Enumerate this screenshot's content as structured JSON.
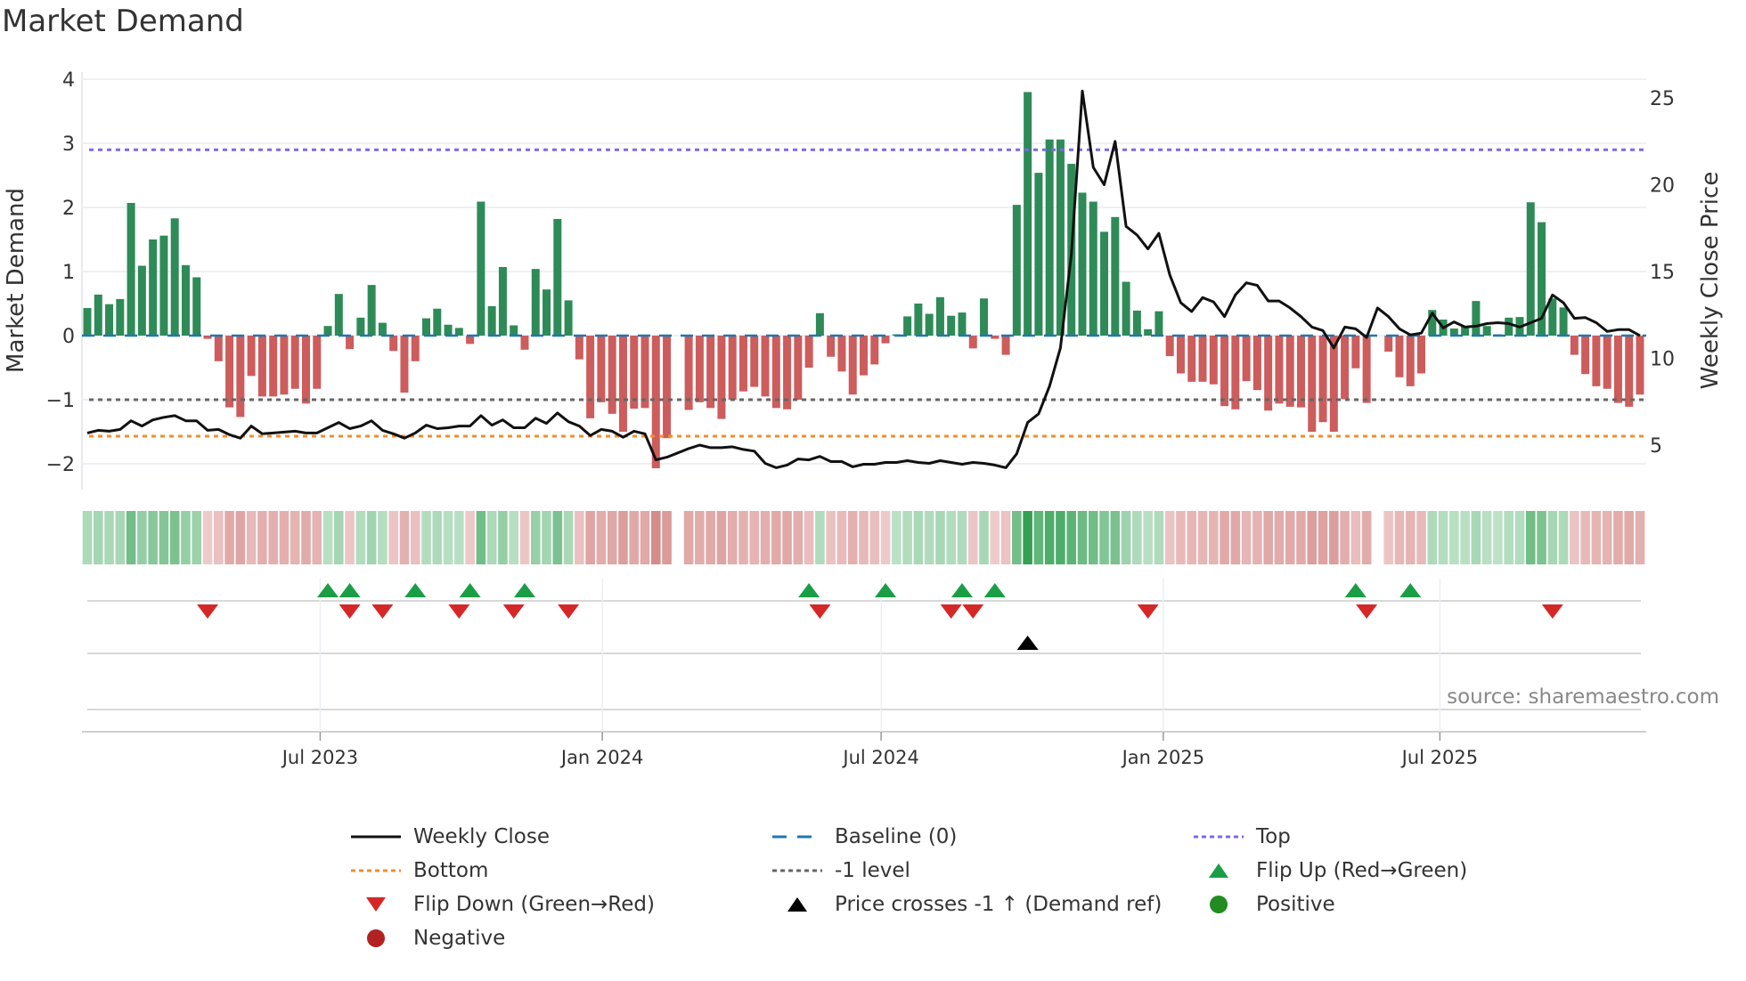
{
  "title": "Market Demand",
  "source": "source: sharemaestro.com",
  "colors": {
    "positive": "#2e8b57",
    "negative": "#cd5c5c",
    "price": "#111111",
    "baseline": "#1f77b4",
    "top": "#7b68ee",
    "bottom": "#f28e2b",
    "minus_one": "#666666",
    "flip_up": "#1a9e45",
    "flip_down": "#d62728",
    "cross": "#000000",
    "pos_dot": "#228b22",
    "neg_dot": "#b22222"
  },
  "legend": [
    {
      "label": "Weekly Close",
      "symbol": "solid-line",
      "color": "#111111"
    },
    {
      "label": "Baseline (0)",
      "symbol": "dashed-line",
      "color": "#1f77b4"
    },
    {
      "label": "Top",
      "symbol": "dotted-line",
      "color": "#7b68ee"
    },
    {
      "label": "Bottom",
      "symbol": "dotted-line",
      "color": "#f28e2b"
    },
    {
      "label": "-1 level",
      "symbol": "dotted-line",
      "color": "#666666"
    },
    {
      "label": "Flip Up (Red→Green)",
      "symbol": "triangle-up",
      "color": "#1a9e45"
    },
    {
      "label": "Flip Down (Green→Red)",
      "symbol": "triangle-down",
      "color": "#d62728"
    },
    {
      "label": "Price crosses -1 ↑ (Demand ref)",
      "symbol": "triangle-up",
      "color": "#000000"
    },
    {
      "label": "Positive",
      "symbol": "circle",
      "color": "#228b22"
    },
    {
      "label": "Negative",
      "symbol": "circle",
      "color": "#b22222"
    }
  ],
  "chart_data": {
    "type": "bar",
    "title": "Market Demand",
    "ylabel": "Market Demand",
    "y2label": "Weekly Close Price",
    "ylim": [
      -2.5,
      4.15
    ],
    "y2lim": [
      0.9,
      26.9
    ],
    "yticks": [
      -2,
      -1,
      0,
      1,
      2,
      3,
      4
    ],
    "ytick_labels": [
      "−2",
      "−1",
      "0",
      "1",
      "2",
      "3",
      "4"
    ],
    "y2ticks": [
      5,
      10,
      15,
      20,
      25
    ],
    "y2tick_labels": [
      "5",
      "10",
      "15",
      "20",
      "25"
    ],
    "xticks": [
      {
        "label": "Jul 2023",
        "week": 21.3
      },
      {
        "label": "Jan 2024",
        "week": 47.1
      },
      {
        "label": "Jul 2024",
        "week": 72.6
      },
      {
        "label": "Jan 2025",
        "week": 98.4
      },
      {
        "label": "Jul 2025",
        "week": 123.7
      }
    ],
    "levels": {
      "top": 2.9,
      "baseline": 0,
      "minus_one": -1,
      "bottom": -1.57
    },
    "demand": [
      0.43,
      0.64,
      0.49,
      0.57,
      2.07,
      1.09,
      1.5,
      1.56,
      1.83,
      1.1,
      0.91,
      -0.05,
      -0.4,
      -1.12,
      -1.27,
      -0.63,
      -0.95,
      -0.95,
      -0.92,
      -0.83,
      -1.06,
      -0.83,
      0.15,
      0.65,
      -0.21,
      0.28,
      0.79,
      0.2,
      -0.24,
      -0.89,
      -0.4,
      0.27,
      0.42,
      0.17,
      0.12,
      -0.13,
      2.09,
      0.46,
      1.07,
      0.16,
      -0.22,
      1.04,
      0.72,
      1.82,
      0.55,
      -0.37,
      -1.29,
      -1.04,
      -1.22,
      -1.5,
      -1.14,
      -1.13,
      -2.07,
      -1.6,
      null,
      -1.16,
      -1.04,
      -1.13,
      -1.3,
      -1.0,
      -0.87,
      -0.8,
      -0.95,
      -1.13,
      -1.15,
      -1.0,
      -0.5,
      0.35,
      -0.33,
      -0.56,
      -0.92,
      -0.62,
      -0.45,
      -0.12,
      0.02,
      0.3,
      0.5,
      0.34,
      0.6,
      0.31,
      0.36,
      -0.2,
      0.58,
      -0.05,
      -0.3,
      2.04,
      3.8,
      2.54,
      3.06,
      3.06,
      2.68,
      2.23,
      2.09,
      1.62,
      1.85,
      0.84,
      0.39,
      0.1,
      0.38,
      -0.32,
      -0.59,
      -0.72,
      -0.72,
      -0.76,
      -1.1,
      -1.15,
      -0.71,
      -0.85,
      -1.17,
      -1.06,
      -1.11,
      -1.12,
      -1.5,
      -1.35,
      -1.5,
      -0.99,
      -0.51,
      -1.05,
      null,
      -0.25,
      -0.65,
      -0.79,
      -0.59,
      0.4,
      0.25,
      0.11,
      0.15,
      0.54,
      0.15,
      0.02,
      0.28,
      0.29,
      2.08,
      1.77,
      0.58,
      0.44,
      -0.3,
      -0.6,
      -0.79,
      -0.83,
      -1.05,
      -1.11,
      -0.92
    ],
    "price": [
      5.7,
      5.85,
      5.8,
      5.9,
      6.4,
      6.1,
      6.45,
      6.6,
      6.7,
      6.4,
      6.4,
      5.85,
      5.9,
      5.6,
      5.4,
      6.1,
      5.65,
      5.7,
      5.75,
      5.8,
      5.7,
      5.7,
      6.0,
      6.3,
      5.95,
      6.1,
      6.4,
      5.85,
      5.65,
      5.4,
      5.7,
      6.15,
      5.95,
      6.0,
      6.1,
      6.1,
      6.7,
      6.15,
      6.45,
      6.0,
      6.0,
      6.55,
      6.25,
      6.85,
      6.35,
      6.1,
      5.55,
      5.9,
      5.8,
      5.45,
      5.8,
      5.65,
      4.15,
      4.3,
      4.55,
      4.8,
      5.0,
      4.85,
      4.85,
      4.9,
      4.75,
      4.65,
      3.95,
      3.7,
      3.85,
      4.2,
      4.15,
      4.35,
      4.05,
      4.05,
      3.75,
      3.9,
      3.9,
      4.0,
      4.0,
      4.1,
      4.0,
      3.95,
      4.1,
      4.0,
      3.9,
      4.0,
      3.95,
      3.85,
      3.7,
      4.5,
      6.3,
      6.8,
      8.4,
      10.6,
      16.0,
      25.4,
      21.0,
      20.0,
      22.5,
      17.6,
      17.1,
      16.3,
      17.2,
      14.8,
      13.2,
      12.7,
      13.5,
      13.25,
      12.4,
      13.65,
      14.35,
      14.2,
      13.3,
      13.3,
      12.9,
      12.4,
      11.8,
      11.6,
      10.6,
      11.8,
      11.7,
      11.2,
      12.9,
      12.4,
      11.7,
      11.35,
      11.45,
      12.6,
      11.75,
      12.1,
      11.8,
      11.85,
      12.0,
      12.05,
      12.0,
      11.8,
      12.05,
      12.3,
      13.65,
      13.2,
      12.3,
      12.35,
      12.05,
      11.55,
      11.65,
      11.65,
      11.3
    ],
    "flip_up_weeks": [
      22,
      24,
      30,
      35,
      40,
      66,
      73,
      80,
      83,
      116,
      121
    ],
    "flip_down_weeks": [
      11,
      24,
      27,
      34,
      39,
      44,
      67,
      79,
      81,
      97,
      117,
      134
    ],
    "price_cross_weeks": [
      86
    ]
  }
}
